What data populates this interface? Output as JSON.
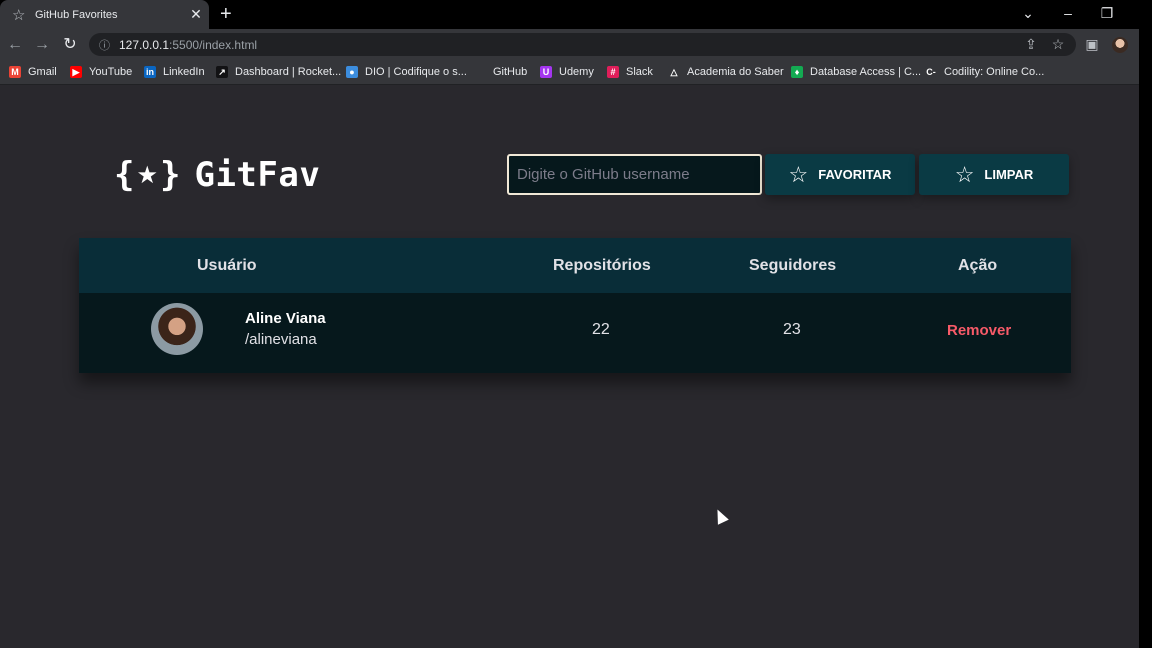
{
  "browser": {
    "tab_title": "GitHub Favorites",
    "tab_icon": "star-icon",
    "new_tab_symbol": "+",
    "close_symbol": "✕",
    "url_host": "127.0.0.1",
    "url_path": ":5500/index.html",
    "bookmarks": [
      {
        "label": "Gmail",
        "icon": "gmail-icon",
        "color": "#ea4335",
        "glyph": "M"
      },
      {
        "label": "YouTube",
        "icon": "youtube-icon",
        "color": "#ff0000",
        "glyph": "▶"
      },
      {
        "label": "LinkedIn",
        "icon": "linkedin-icon",
        "color": "#0a66c2",
        "glyph": "in"
      },
      {
        "label": "Dashboard | Rocket...",
        "icon": "rocketseat-icon",
        "color": "#121214",
        "glyph": "↗"
      },
      {
        "label": "DIO | Codifique o s...",
        "icon": "dio-icon",
        "color": "#3c8dde",
        "glyph": "●"
      },
      {
        "label": "GitHub",
        "icon": "github-icon",
        "color": "#35363a",
        "glyph": ""
      },
      {
        "label": "Udemy",
        "icon": "udemy-icon",
        "color": "#a435f0",
        "glyph": "U"
      },
      {
        "label": "Slack",
        "icon": "slack-icon",
        "color": "#e01e5a",
        "glyph": "#"
      },
      {
        "label": "Academia do Saber",
        "icon": "academia-icon",
        "color": "#35363a",
        "glyph": "△"
      },
      {
        "label": "Database Access | C...",
        "icon": "mongodb-icon",
        "color": "#13aa52",
        "glyph": "♦"
      },
      {
        "label": "Codility: Online Co...",
        "icon": "codility-icon",
        "color": "#35363a",
        "glyph": "C-"
      }
    ]
  },
  "app": {
    "logo_open": "{",
    "logo_star": "★",
    "logo_close": "}",
    "logo_name": "GitFav",
    "search_placeholder": "Digite o GitHub username",
    "favorite_label": "FAVORITAR",
    "clear_label": "LIMPAR",
    "button_star": "☆"
  },
  "table": {
    "headers": {
      "user": "Usuário",
      "repos": "Repositórios",
      "followers": "Seguidores",
      "action": "Ação"
    },
    "rows": [
      {
        "name": "Aline Viana",
        "login": "/alineviana",
        "repositories": "22",
        "followers": "23",
        "action": "Remover"
      }
    ]
  },
  "colors": {
    "accent": "#065e7c",
    "header_bg": "#092d38",
    "row_bg": "#06181c",
    "danger": "#f75a68"
  }
}
